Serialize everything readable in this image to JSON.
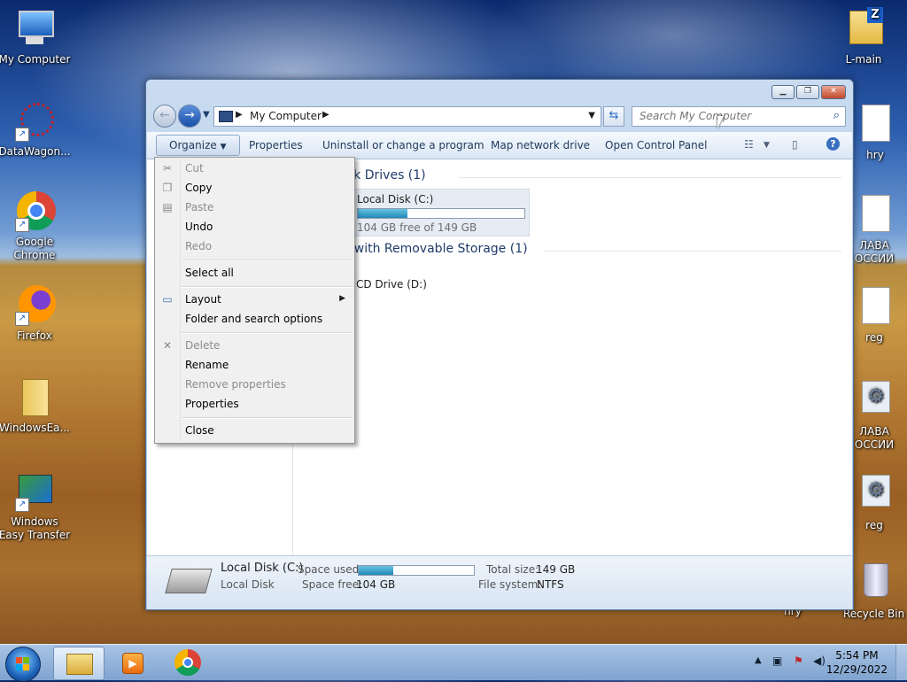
{
  "desktop": {
    "left_icons": [
      {
        "label": "My Computer"
      },
      {
        "label": "DataWagon..."
      },
      {
        "label": "Google Chrome"
      },
      {
        "label": "Firefox"
      },
      {
        "label": "WindowsEa..."
      },
      {
        "label": "Windows Easy Transfer"
      }
    ],
    "right_icons": [
      {
        "label": "L-main"
      },
      {
        "label": "hry"
      },
      {
        "label": "ЛАВА ОССИИ"
      },
      {
        "label": "reg"
      },
      {
        "label": "ЛАВА ОССИИ"
      },
      {
        "label": "reg"
      },
      {
        "label": "Recycle Bin"
      }
    ],
    "partial_label": "hry"
  },
  "window": {
    "address": {
      "location": "My Computer"
    },
    "search": {
      "placeholder": "Search My Computer"
    },
    "commands": {
      "organize": "Organize",
      "properties": "Properties",
      "uninstall": "Uninstall or change a program",
      "map_drive": "Map network drive",
      "control_panel": "Open Control Panel"
    },
    "groups": {
      "hdd": "isk Drives (1)",
      "removable": "s with Removable Storage (1)"
    },
    "drive_c": {
      "name": "Local Disk (C:)",
      "free_text": "104 GB free of 149 GB",
      "used_fraction": 0.3
    },
    "drive_d": {
      "name": "CD Drive (D:)"
    },
    "details": {
      "name": "Local Disk (C:)",
      "type": "Local Disk",
      "space_used_label": "Space used:",
      "space_free_label": "Space free:",
      "space_free_value": "104 GB",
      "total_size_label": "Total size:",
      "total_size_value": "149 GB",
      "file_system_label": "File system:",
      "file_system_value": "NTFS"
    }
  },
  "organize_menu": {
    "items": {
      "cut": "Cut",
      "copy": "Copy",
      "paste": "Paste",
      "undo": "Undo",
      "redo": "Redo",
      "select_all": "Select all",
      "layout": "Layout",
      "folder_options": "Folder and search options",
      "delete": "Delete",
      "rename": "Rename",
      "remove_properties": "Remove properties",
      "properties": "Properties",
      "close": "Close"
    }
  },
  "taskbar": {
    "clock_time": "5:54 PM",
    "clock_date": "12/29/2022"
  },
  "colors": {
    "accent": "#1f3b6b",
    "progress": "#2088b7"
  }
}
